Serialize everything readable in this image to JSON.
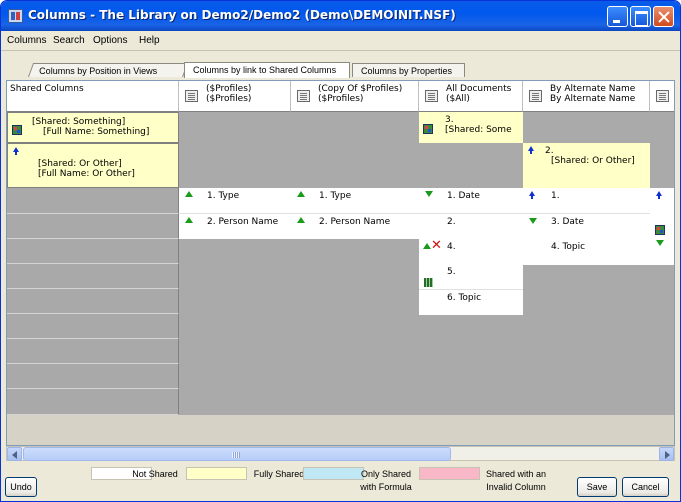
{
  "window": {
    "title": "Columns - The Library on Demo2/Demo2 (Demo\\DEMOINIT.NSF)"
  },
  "menu": [
    "Columns",
    "Search",
    "Options",
    "Help"
  ],
  "tabs": [
    "Columns by Position in Views",
    "Columns by link to Shared Columns",
    "Columns by Properties"
  ],
  "headers": {
    "shared": "Shared Columns",
    "col1": [
      "($Profiles)",
      "($Profiles)"
    ],
    "col2": [
      "(Copy Of $Profiles)",
      "($Profiles)"
    ],
    "col3": [
      "All Documents",
      "($All)"
    ],
    "col4": [
      "By Alternate Name",
      "By Alternate Name"
    ]
  },
  "shared_rows": {
    "r1": [
      "[Shared: Something]",
      "[Full Name: Something]"
    ],
    "r2": [
      "[Shared: Or Other]",
      "[Full Name: Or Other]"
    ]
  },
  "cells": {
    "c3r1": [
      "3.",
      "[Shared: Some"
    ],
    "c4r2": [
      "2.",
      "[Shared: Or Other]"
    ],
    "c1a": "1. Type",
    "c1b": "2. Person Name",
    "c2a": "1. Type",
    "c2b": "2. Person Name",
    "c3a": "1. Date",
    "c3b": "2.",
    "c3c": "4.",
    "c3d": "5.",
    "c3e": "6. Topic",
    "c4a": "1.",
    "c4b": "3. Date",
    "c4c": "4. Topic"
  },
  "legend": {
    "not_shared": "Not Shared",
    "fully_shared": "Fully Shared",
    "formula": [
      "Only Shared",
      "with Formula"
    ],
    "invalid": [
      "Shared with an",
      "Invalid Column"
    ],
    "colors": {
      "not_shared": "#ffffff",
      "fully_shared": "#ffffc8",
      "formula": "#bfe8f4",
      "invalid": "#f8b8c8"
    }
  },
  "buttons": {
    "undo": "Undo",
    "save": "Save",
    "cancel": "Cancel"
  }
}
